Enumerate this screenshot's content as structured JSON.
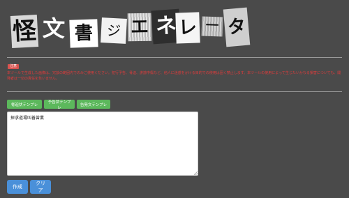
{
  "title": {
    "tiles": [
      "怪",
      "文",
      "書",
      "ジ",
      "エ",
      "ネ",
      "レ",
      "ー",
      "タ"
    ]
  },
  "notice": {
    "badge": "注意",
    "text": "本ツールで生成した画像は、冗談の範囲内でのみご使用ください。犯行予告、脅迫、誹謗中傷など、他人に迷惑をかける目的での使用は固く禁止します。本ツールの使用によって生じたいかなる損害についても、開発者は一切の責任を負いません。"
  },
  "templates": {
    "buttons": [
      "脅迫状テンプレ",
      "予告状テンプレ",
      "告発文テンプレ"
    ]
  },
  "editor": {
    "value": "探求道場叫善曾業"
  },
  "actions": {
    "create_label": "作成",
    "clear_label": "クリア"
  },
  "colors": {
    "background": "#4a4a4a",
    "template_button": "#5cb85c",
    "action_button": "#4a90d9",
    "notice_text": "#e23b3b",
    "badge": "#d9534f"
  }
}
